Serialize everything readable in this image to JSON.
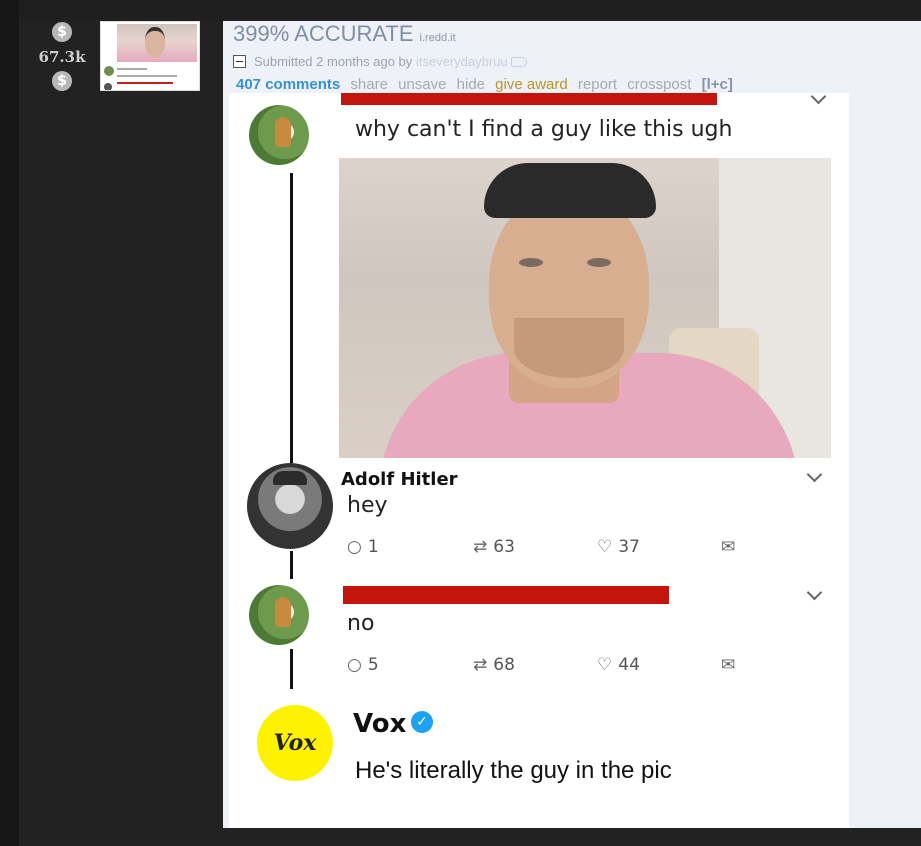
{
  "vote": {
    "score": "67.3k",
    "up_glyph": "$",
    "down_glyph": "$"
  },
  "post": {
    "title": "399% ACCURATE",
    "domain": "i.redd.it",
    "submitted_prefix": "Submitted 2 months ago by",
    "author": "itseverydaybruu",
    "buttons": {
      "comments": "407 comments",
      "share": "share",
      "unsave": "unsave",
      "hide": "hide",
      "give_award": "give award",
      "report": "report",
      "crosspost": "crosspost",
      "lc": "[l+c]"
    }
  },
  "image": {
    "tweet1_text": "why can't I find a guy like this ugh",
    "tweet2": {
      "name": "Adolf Hitler",
      "text": "hey",
      "replies": "1",
      "retweets": "63",
      "likes": "37"
    },
    "tweet3": {
      "text": "no",
      "replies": "5",
      "retweets": "68",
      "likes": "44"
    },
    "vox": {
      "logo": "Vox",
      "name": "Vox",
      "text": "He's literally the guy in the pic"
    }
  },
  "icons": {
    "reply": "○",
    "retweet": "⇄",
    "like": "♡",
    "dm": "✉",
    "verified": "✓"
  },
  "colors": {
    "accent_link": "#3791d8",
    "award": "#b8962a",
    "redaction": "#c4150d",
    "vox_yellow": "#fff200"
  }
}
